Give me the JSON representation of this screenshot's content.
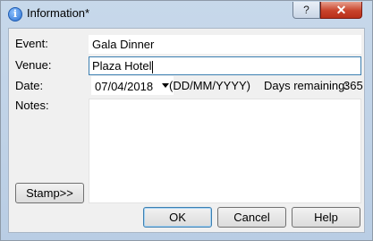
{
  "window": {
    "title": "Information*",
    "help_label": "?",
    "close_label": "✕",
    "title_icon": "info-icon",
    "help_icon": "question-icon",
    "close_icon": "close-icon"
  },
  "form": {
    "event_label": "Event:",
    "event_value": "Gala Dinner",
    "venue_label": "Venue:",
    "venue_value": "Plaza Hotel",
    "date_label": "Date:",
    "date_value": "07/04/2018",
    "date_format_hint": "(DD/MM/YYYY)",
    "days_remaining_label": "Days remaining:",
    "days_remaining_value": "365",
    "notes_label": "Notes:",
    "notes_value": ""
  },
  "buttons": {
    "stamp": "Stamp>>",
    "ok": "OK",
    "cancel": "Cancel",
    "help": "Help"
  }
}
